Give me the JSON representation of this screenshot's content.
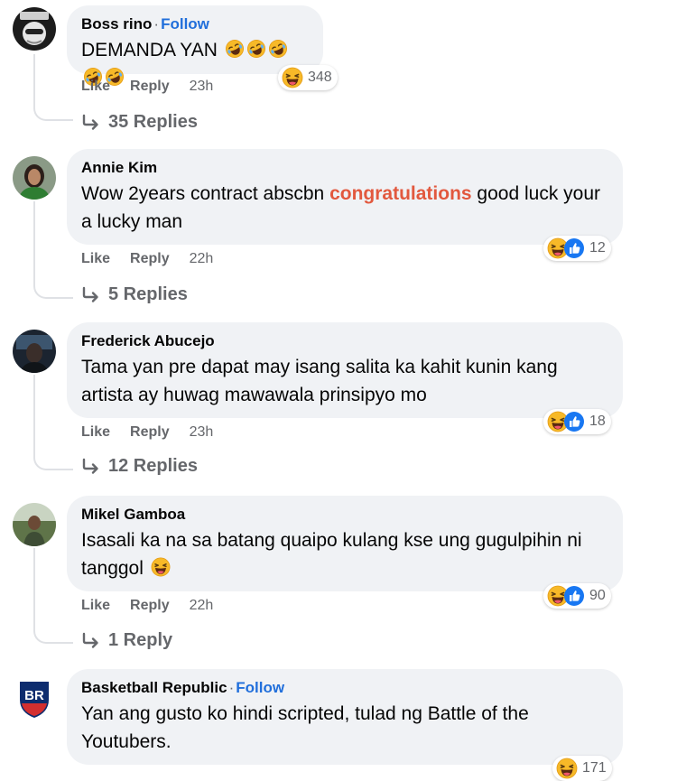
{
  "comments": [
    {
      "name": "Boss rino",
      "follow": "Follow",
      "text": "DEMANDA YAN",
      "actions": {
        "like": "Like",
        "reply": "Reply",
        "time": "23h"
      },
      "reaction_icons": [
        "laughing-face-icon"
      ],
      "reaction_count": "348",
      "replies": "35 Replies"
    },
    {
      "name": "Annie Kim",
      "text_before": "Wow 2years contract abscbn ",
      "text_highlight": "congratulations",
      "text_after": " good luck your a lucky man",
      "highlight_color": "#e2583e",
      "actions": {
        "like": "Like",
        "reply": "Reply",
        "time": "22h"
      },
      "reaction_icons": [
        "laughing-face-icon",
        "like-thumb-icon"
      ],
      "reaction_count": "12",
      "replies": "5 Replies"
    },
    {
      "name": "Frederick Abucejo",
      "text": "Tama yan pre dapat may isang salita ka kahit kunin kang artista ay huwag mawawala prinsipyo mo",
      "actions": {
        "like": "Like",
        "reply": "Reply",
        "time": "23h"
      },
      "reaction_icons": [
        "laughing-face-icon",
        "like-thumb-icon"
      ],
      "reaction_count": "18",
      "replies": "12 Replies"
    },
    {
      "name": "Mikel Gamboa",
      "text": "Isasali ka na sa batang quaipo kulang kse ung gugulpihin ni tanggol",
      "actions": {
        "like": "Like",
        "reply": "Reply",
        "time": "22h"
      },
      "reaction_icons": [
        "laughing-face-icon",
        "like-thumb-icon"
      ],
      "reaction_count": "90",
      "replies": "1 Reply"
    },
    {
      "name": "Basketball Republic",
      "follow": "Follow",
      "avatar_text": "BR",
      "text": "Yan ang gusto ko hindi scripted, tulad ng Battle of the Youtubers.",
      "reaction_icons": [
        "laughing-face-icon"
      ],
      "reaction_count": "171"
    }
  ],
  "colors": {
    "bubble": "#f0f2f5",
    "link": "#216fdb",
    "secondary_text": "#65676b",
    "like_blue": "#1877f2",
    "emoji_yellow": "#f7b928"
  }
}
